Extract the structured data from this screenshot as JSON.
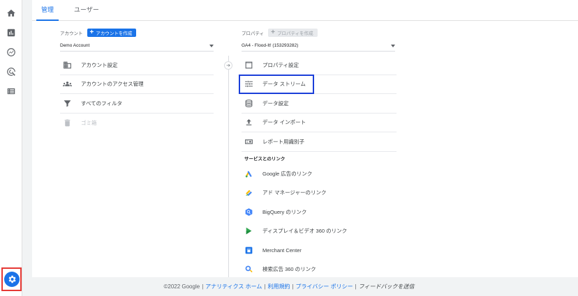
{
  "tabs": {
    "admin": "管理",
    "users": "ユーザー"
  },
  "account": {
    "label": "アカウント",
    "create_button": "アカウントを作成",
    "selected": "Demo Account",
    "items": [
      {
        "label": "アカウント設定",
        "icon": "building-icon"
      },
      {
        "label": "アカウントのアクセス管理",
        "icon": "people-icon"
      },
      {
        "label": "すべてのフィルタ",
        "icon": "filter-icon"
      },
      {
        "label": "ゴミ箱",
        "icon": "trash-icon"
      }
    ]
  },
  "property": {
    "label": "プロパティ",
    "create_button": "プロパティを作成",
    "selected": "GA4 - Flood-It! (153293282)",
    "items": [
      {
        "label": "プロパティ設定",
        "icon": "window-icon"
      },
      {
        "label": "データ ストリーム",
        "icon": "stream-icon"
      },
      {
        "label": "データ設定",
        "icon": "database-icon"
      },
      {
        "label": "データ インポート",
        "icon": "upload-icon"
      },
      {
        "label": "レポート用識別子",
        "icon": "id-icon"
      }
    ],
    "links_section": "サービスとのリンク",
    "links": [
      {
        "label": "Google 広告のリンク",
        "icon": "google-ads-icon"
      },
      {
        "label": "アド マネージャーのリンク",
        "icon": "ad-manager-icon"
      },
      {
        "label": "BigQuery のリンク",
        "icon": "bigquery-icon"
      },
      {
        "label": "ディスプレイ＆ビデオ 360 のリンク",
        "icon": "dv360-icon"
      },
      {
        "label": "Merchant Center",
        "icon": "merchant-center-icon"
      },
      {
        "label": "検索広告 360 のリンク",
        "icon": "search-ads-360-icon"
      }
    ]
  },
  "footer": {
    "copyright": "©2022 Google",
    "home": "アナリティクス ホーム",
    "terms": "利用規約",
    "privacy": "プライバシー ポリシー",
    "feedback": "フィードバックを送信",
    "feedback_overlay": "フィードバック"
  },
  "colors": {
    "accent": "#1a73e8",
    "highlight_red": "#e53935",
    "highlight_blue": "#1b3fd9"
  }
}
